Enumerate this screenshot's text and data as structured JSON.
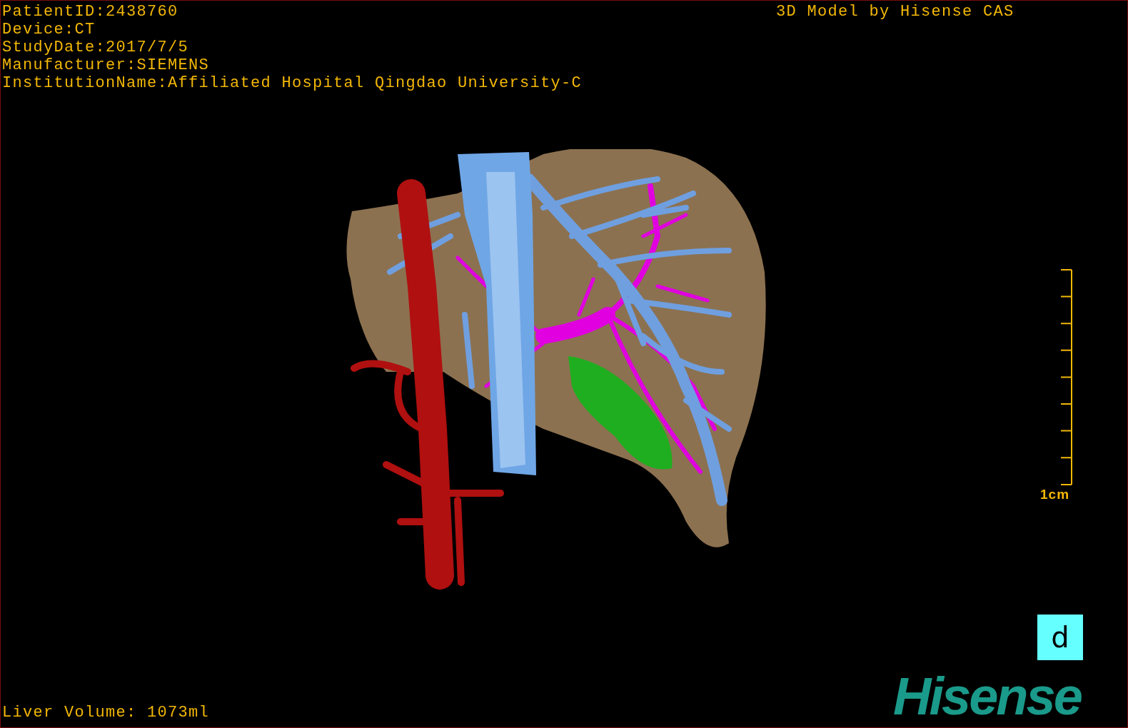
{
  "study_info": [
    "PatientID:2438760",
    "Device:CT",
    "StudyDate:2017/7/5",
    "Manufacturer:SIEMENS",
    "InstitutionName:Affiliated Hospital Qingdao University-C"
  ],
  "model_credit": "3D Model by Hisense CAS",
  "scale_bar": {
    "label": "1cm"
  },
  "orientation_marker": "d",
  "liver_volume": "Liver Volume: 1073ml",
  "logo": "Hisense"
}
